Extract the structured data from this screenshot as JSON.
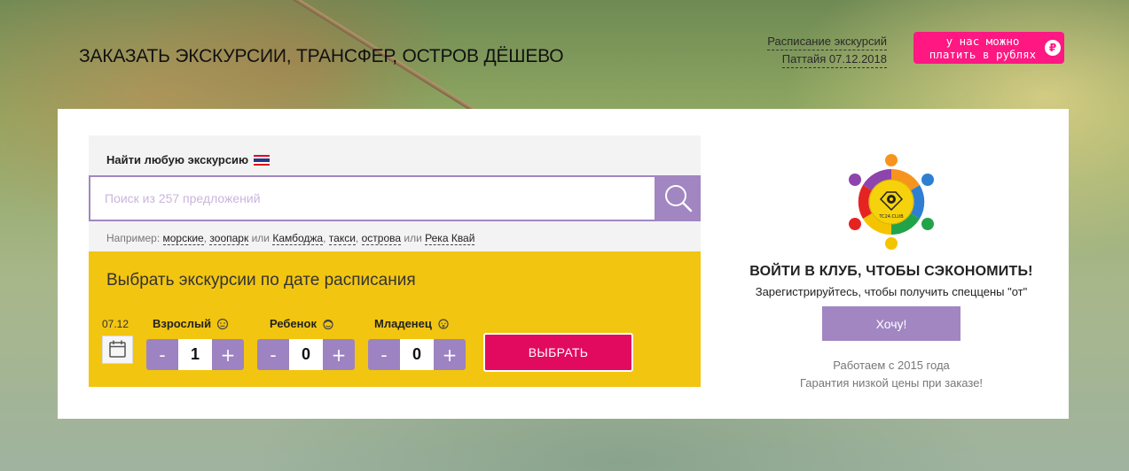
{
  "header": {
    "title": "ЗАКАЗАТЬ ЭКСКУРСИИ, ТРАНСФЕР, ОСТРОВ ДЁШЕВО",
    "schedule_line1": "Расписание экскурсий",
    "schedule_line2": "Паттайя 07.12.2018",
    "rub_badge_line1": "у нас можно",
    "rub_badge_line2": "платить в рублях",
    "rub_symbol": "₽"
  },
  "search": {
    "label": "Найти любую экскурсию",
    "placeholder": "Поиск из 257 предложений",
    "value": "",
    "examples_prefix": "Например:",
    "examples": [
      "морские",
      "зоопарк",
      "Камбоджа",
      "такси",
      "острова",
      "Река Квай"
    ],
    "sep_comma": ",",
    "sep_or": "или"
  },
  "date_picker": {
    "title": "Выбрать экскурсии по дате расписания",
    "date": "07.12",
    "passengers": [
      {
        "label": "Взрослый",
        "value": "1"
      },
      {
        "label": "Ребенок",
        "value": "0"
      },
      {
        "label": "Младенец",
        "value": "0"
      }
    ],
    "minus": "-",
    "plus": "+",
    "choose_label": "ВЫБРАТЬ"
  },
  "club": {
    "logo_text": "TC24.CLUB",
    "title": "ВОЙТИ В КЛУБ, ЧТОБЫ СЭКОНОМИТЬ!",
    "subtitle": "Зарегистрируйтесь, чтобы получить спеццены \"от\"",
    "button_label": "Хочу!",
    "note_line1": "Работаем с 2015 года",
    "note_line2": "Гарантия низкой цены при заказе!"
  },
  "colors": {
    "accent_purple": "#a186c2",
    "accent_pink": "#e10a5f",
    "badge_pink": "#ff1782",
    "date_block_yellow": "#f2c511"
  }
}
